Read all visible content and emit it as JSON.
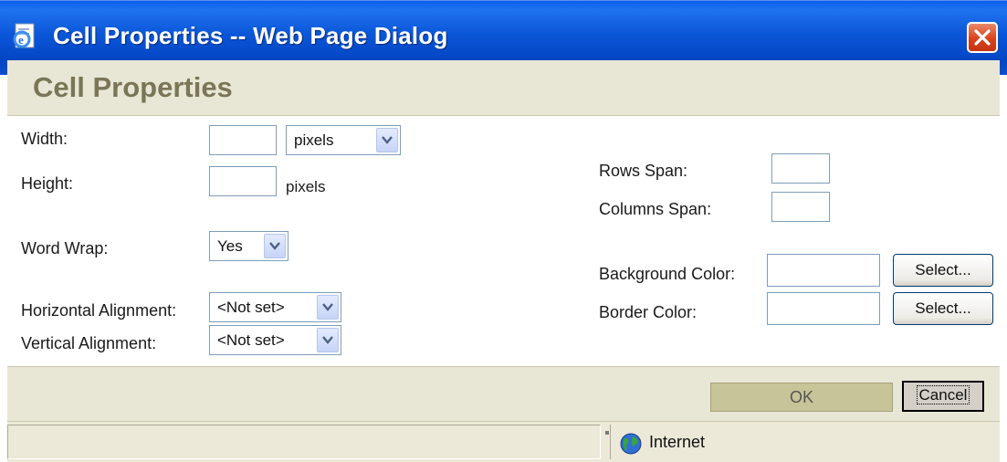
{
  "window": {
    "title": "Cell Properties -- Web Page Dialog"
  },
  "header": {
    "title": "Cell Properties"
  },
  "form": {
    "width_label": "Width:",
    "width_value": "",
    "width_unit": "pixels",
    "height_label": "Height:",
    "height_value": "",
    "height_unit": "pixels",
    "word_wrap_label": "Word Wrap:",
    "word_wrap_value": "Yes",
    "h_align_label": "Horizontal Alignment:",
    "h_align_value": "<Not set>",
    "v_align_label": "Vertical Alignment:",
    "v_align_value": "<Not set>",
    "rows_span_label": "Rows Span:",
    "rows_span_value": "",
    "cols_span_label": "Columns Span:",
    "cols_span_value": "",
    "bg_color_label": "Background Color:",
    "bg_color_value": "",
    "border_color_label": "Border Color:",
    "border_color_value": "",
    "select_label": "Select..."
  },
  "footer": {
    "ok_label": "OK",
    "cancel_label": "Cancel"
  },
  "statusbar": {
    "status_text": "",
    "zone_label": "Internet"
  },
  "colors": {
    "titlebar": "#0a5fea",
    "header_band": "#e8e7d6",
    "header_text": "#7a7656",
    "ok_button": "#c8c499",
    "close_button": "#d9421d"
  },
  "icons": {
    "title": "ie-page-icon",
    "close": "close-icon",
    "dropdown": "chevron-down-icon",
    "zone": "globe-icon"
  }
}
